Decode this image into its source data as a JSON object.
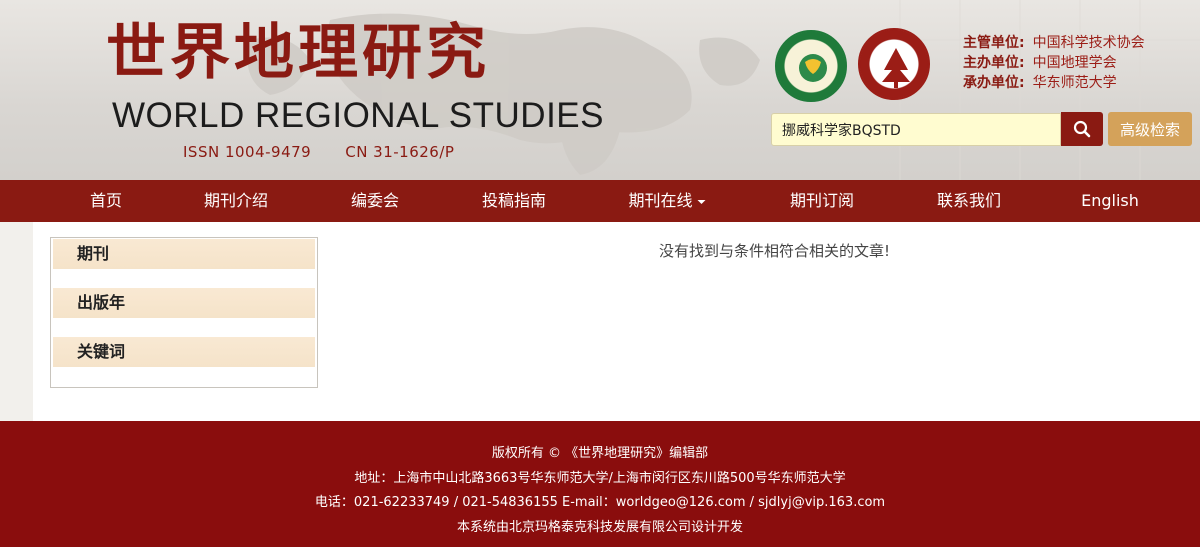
{
  "header": {
    "title_cn": "世界地理研究",
    "title_en": "WORLD REGIONAL STUDIES",
    "issn": "ISSN 1004-9479",
    "cn": "CN 31-1626/P",
    "sponsors": [
      {
        "key": "主管单位:",
        "value": "中国科学技术协会"
      },
      {
        "key": "主办单位:",
        "value": "中国地理学会"
      },
      {
        "key": "承办单位:",
        "value": "华东师范大学"
      }
    ]
  },
  "search": {
    "value": "挪威科学家BQSTD",
    "advanced_label": "高级检索"
  },
  "nav": {
    "items": [
      "首页",
      "期刊介绍",
      "编委会",
      "投稿指南",
      "期刊在线",
      "期刊订阅",
      "联系我们",
      "English"
    ]
  },
  "sidebar": {
    "facets": [
      "期刊",
      "出版年",
      "关键词"
    ]
  },
  "main": {
    "empty_message": "没有找到与条件相符合相关的文章!"
  },
  "footer": {
    "copyright": "版权所有 © 《世界地理研究》编辑部",
    "address": "地址：上海市中山北路3663号华东师范大学/上海市闵行区东川路500号华东师范大学",
    "contact": "电话：021-62233749 / 021-54836155    E-mail：worldgeo@126.com / sjdlyj@vip.163.com",
    "developer": "本系统由北京玛格泰克科技发展有限公司设计开发"
  },
  "colors": {
    "brand": "#8a1a12",
    "footer": "#8a0d0d",
    "advanced_button": "#d4a25a",
    "search_bg": "#fffcd0"
  },
  "icons": {
    "search": "search-icon",
    "dropdown": "caret-down-icon"
  }
}
